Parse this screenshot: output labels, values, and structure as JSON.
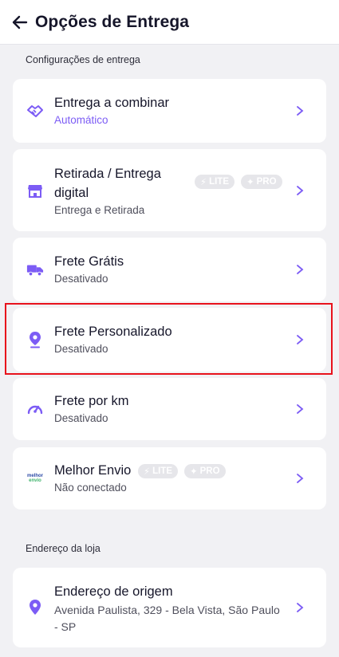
{
  "header": {
    "title": "Opções de Entrega"
  },
  "sections": {
    "delivery_settings": "Configurações de entrega",
    "store_address": "Endereço da loja"
  },
  "badges": {
    "lite": "LITE",
    "pro": "PRO"
  },
  "items": [
    {
      "title": "Entrega a combinar",
      "subtitle": "Automático"
    },
    {
      "title": "Retirada / Entrega digital",
      "title_line1": "Retirada / Entrega",
      "title_line2": "digital",
      "subtitle": "Entrega e Retirada"
    },
    {
      "title": "Frete Grátis",
      "subtitle": "Desativado"
    },
    {
      "title": "Frete Personalizado",
      "subtitle": "Desativado"
    },
    {
      "title": "Frete por km",
      "subtitle": "Desativado"
    },
    {
      "title": "Melhor Envio",
      "subtitle": "Não conectado",
      "logo_text_a": "melhor",
      "logo_text_b": "envio"
    }
  ],
  "origin": {
    "title": "Endereço de origem",
    "address_line1": "Avenida Paulista, 329 - Bela Vista, São Paulo",
    "address_line2": "- SP"
  },
  "colors": {
    "accent": "#7c5cf5",
    "highlight": "#e8121c",
    "badge_bg": "#e6e6ea"
  }
}
